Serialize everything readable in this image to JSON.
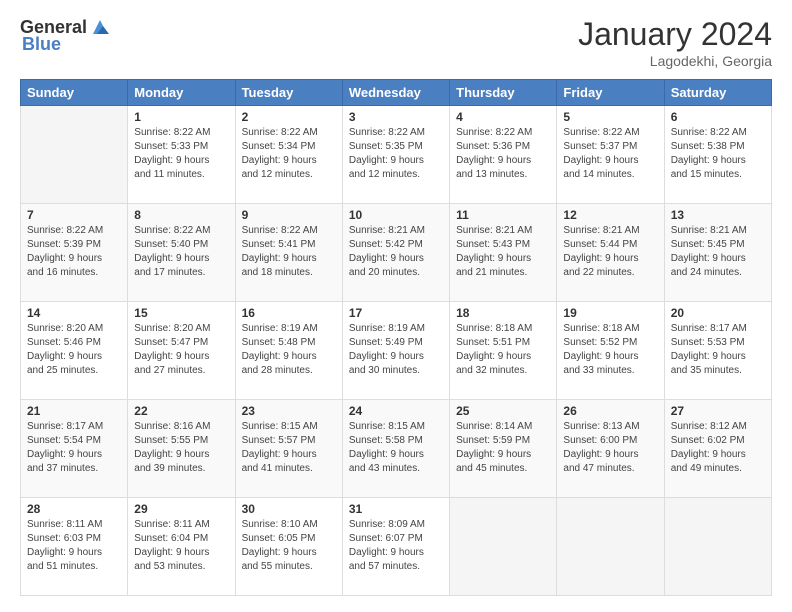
{
  "logo": {
    "general": "General",
    "blue": "Blue"
  },
  "header": {
    "month": "January 2024",
    "location": "Lagodekhi, Georgia"
  },
  "days_of_week": [
    "Sunday",
    "Monday",
    "Tuesday",
    "Wednesday",
    "Thursday",
    "Friday",
    "Saturday"
  ],
  "weeks": [
    [
      {
        "day": "",
        "sunrise": "",
        "sunset": "",
        "daylight": ""
      },
      {
        "day": "1",
        "sunrise": "Sunrise: 8:22 AM",
        "sunset": "Sunset: 5:33 PM",
        "daylight": "Daylight: 9 hours and 11 minutes."
      },
      {
        "day": "2",
        "sunrise": "Sunrise: 8:22 AM",
        "sunset": "Sunset: 5:34 PM",
        "daylight": "Daylight: 9 hours and 12 minutes."
      },
      {
        "day": "3",
        "sunrise": "Sunrise: 8:22 AM",
        "sunset": "Sunset: 5:35 PM",
        "daylight": "Daylight: 9 hours and 12 minutes."
      },
      {
        "day": "4",
        "sunrise": "Sunrise: 8:22 AM",
        "sunset": "Sunset: 5:36 PM",
        "daylight": "Daylight: 9 hours and 13 minutes."
      },
      {
        "day": "5",
        "sunrise": "Sunrise: 8:22 AM",
        "sunset": "Sunset: 5:37 PM",
        "daylight": "Daylight: 9 hours and 14 minutes."
      },
      {
        "day": "6",
        "sunrise": "Sunrise: 8:22 AM",
        "sunset": "Sunset: 5:38 PM",
        "daylight": "Daylight: 9 hours and 15 minutes."
      }
    ],
    [
      {
        "day": "7",
        "sunrise": "Sunrise: 8:22 AM",
        "sunset": "Sunset: 5:39 PM",
        "daylight": "Daylight: 9 hours and 16 minutes."
      },
      {
        "day": "8",
        "sunrise": "Sunrise: 8:22 AM",
        "sunset": "Sunset: 5:40 PM",
        "daylight": "Daylight: 9 hours and 17 minutes."
      },
      {
        "day": "9",
        "sunrise": "Sunrise: 8:22 AM",
        "sunset": "Sunset: 5:41 PM",
        "daylight": "Daylight: 9 hours and 18 minutes."
      },
      {
        "day": "10",
        "sunrise": "Sunrise: 8:21 AM",
        "sunset": "Sunset: 5:42 PM",
        "daylight": "Daylight: 9 hours and 20 minutes."
      },
      {
        "day": "11",
        "sunrise": "Sunrise: 8:21 AM",
        "sunset": "Sunset: 5:43 PM",
        "daylight": "Daylight: 9 hours and 21 minutes."
      },
      {
        "day": "12",
        "sunrise": "Sunrise: 8:21 AM",
        "sunset": "Sunset: 5:44 PM",
        "daylight": "Daylight: 9 hours and 22 minutes."
      },
      {
        "day": "13",
        "sunrise": "Sunrise: 8:21 AM",
        "sunset": "Sunset: 5:45 PM",
        "daylight": "Daylight: 9 hours and 24 minutes."
      }
    ],
    [
      {
        "day": "14",
        "sunrise": "Sunrise: 8:20 AM",
        "sunset": "Sunset: 5:46 PM",
        "daylight": "Daylight: 9 hours and 25 minutes."
      },
      {
        "day": "15",
        "sunrise": "Sunrise: 8:20 AM",
        "sunset": "Sunset: 5:47 PM",
        "daylight": "Daylight: 9 hours and 27 minutes."
      },
      {
        "day": "16",
        "sunrise": "Sunrise: 8:19 AM",
        "sunset": "Sunset: 5:48 PM",
        "daylight": "Daylight: 9 hours and 28 minutes."
      },
      {
        "day": "17",
        "sunrise": "Sunrise: 8:19 AM",
        "sunset": "Sunset: 5:49 PM",
        "daylight": "Daylight: 9 hours and 30 minutes."
      },
      {
        "day": "18",
        "sunrise": "Sunrise: 8:18 AM",
        "sunset": "Sunset: 5:51 PM",
        "daylight": "Daylight: 9 hours and 32 minutes."
      },
      {
        "day": "19",
        "sunrise": "Sunrise: 8:18 AM",
        "sunset": "Sunset: 5:52 PM",
        "daylight": "Daylight: 9 hours and 33 minutes."
      },
      {
        "day": "20",
        "sunrise": "Sunrise: 8:17 AM",
        "sunset": "Sunset: 5:53 PM",
        "daylight": "Daylight: 9 hours and 35 minutes."
      }
    ],
    [
      {
        "day": "21",
        "sunrise": "Sunrise: 8:17 AM",
        "sunset": "Sunset: 5:54 PM",
        "daylight": "Daylight: 9 hours and 37 minutes."
      },
      {
        "day": "22",
        "sunrise": "Sunrise: 8:16 AM",
        "sunset": "Sunset: 5:55 PM",
        "daylight": "Daylight: 9 hours and 39 minutes."
      },
      {
        "day": "23",
        "sunrise": "Sunrise: 8:15 AM",
        "sunset": "Sunset: 5:57 PM",
        "daylight": "Daylight: 9 hours and 41 minutes."
      },
      {
        "day": "24",
        "sunrise": "Sunrise: 8:15 AM",
        "sunset": "Sunset: 5:58 PM",
        "daylight": "Daylight: 9 hours and 43 minutes."
      },
      {
        "day": "25",
        "sunrise": "Sunrise: 8:14 AM",
        "sunset": "Sunset: 5:59 PM",
        "daylight": "Daylight: 9 hours and 45 minutes."
      },
      {
        "day": "26",
        "sunrise": "Sunrise: 8:13 AM",
        "sunset": "Sunset: 6:00 PM",
        "daylight": "Daylight: 9 hours and 47 minutes."
      },
      {
        "day": "27",
        "sunrise": "Sunrise: 8:12 AM",
        "sunset": "Sunset: 6:02 PM",
        "daylight": "Daylight: 9 hours and 49 minutes."
      }
    ],
    [
      {
        "day": "28",
        "sunrise": "Sunrise: 8:11 AM",
        "sunset": "Sunset: 6:03 PM",
        "daylight": "Daylight: 9 hours and 51 minutes."
      },
      {
        "day": "29",
        "sunrise": "Sunrise: 8:11 AM",
        "sunset": "Sunset: 6:04 PM",
        "daylight": "Daylight: 9 hours and 53 minutes."
      },
      {
        "day": "30",
        "sunrise": "Sunrise: 8:10 AM",
        "sunset": "Sunset: 6:05 PM",
        "daylight": "Daylight: 9 hours and 55 minutes."
      },
      {
        "day": "31",
        "sunrise": "Sunrise: 8:09 AM",
        "sunset": "Sunset: 6:07 PM",
        "daylight": "Daylight: 9 hours and 57 minutes."
      },
      {
        "day": "",
        "sunrise": "",
        "sunset": "",
        "daylight": ""
      },
      {
        "day": "",
        "sunrise": "",
        "sunset": "",
        "daylight": ""
      },
      {
        "day": "",
        "sunrise": "",
        "sunset": "",
        "daylight": ""
      }
    ]
  ]
}
